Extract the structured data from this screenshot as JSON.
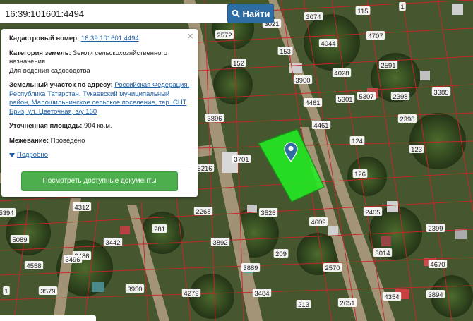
{
  "search": {
    "value": "16:39:101601:4494",
    "button_label": "Найти",
    "button_icon": "search-icon"
  },
  "card": {
    "close_label": "×",
    "cadastral_label": "Кадастровый номер:",
    "cadastral_value": "16:39:101601:4494",
    "category_label": "Категория земель:",
    "category_value": "Земли сельскохозяйственного назначения",
    "usage_value": "Для ведения садоводства",
    "address_label": "Земельный участок по адресу:",
    "address_value": "Российская Федерация, Республика Татарстан, Тукаевский муниципальный район, Малошильнинское сельское поселение, тер. СНТ Бриз, ул. Цветочная, з/у 160",
    "area_label": "Уточненная площадь:",
    "area_value": "904 кв.м.",
    "survey_label": "Межевание:",
    "survey_value": "Проведено",
    "more_label": "Подробно",
    "more_icon": "triangle-down-icon",
    "docs_button": "Посмотреть доступные документы"
  },
  "map": {
    "highlight_color": "#22ee22",
    "parcel_line_color": "#c62828",
    "marker_icon": "map-pin-icon",
    "labels": [
      "3074",
      "115",
      "1",
      "2572",
      "3021",
      "4044",
      "4707",
      "153",
      "152",
      "4028",
      "2591",
      "3900",
      "5301",
      "2398",
      "3385",
      "4461",
      "5307",
      "2398",
      "3896",
      "4461",
      "124",
      "123",
      "3701",
      "5216",
      "126",
      "4312",
      "2268",
      "3526",
      "2405",
      "5394",
      "281",
      "4609",
      "2399",
      "5089",
      "3442",
      "3892",
      "3014",
      "3486",
      "3496",
      "209",
      "4670",
      "4558",
      "3889",
      "2570",
      "3579",
      "3950",
      "4279",
      "3484",
      "4354",
      "3894",
      "213",
      "2651",
      "1"
    ]
  }
}
